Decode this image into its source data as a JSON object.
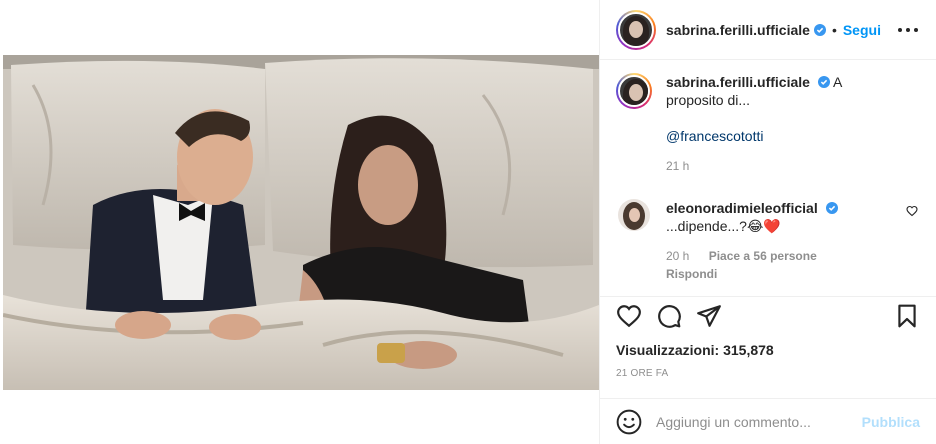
{
  "post": {
    "username": "sabrina.ferilli.ufficiale",
    "follow_label": "Segui",
    "separator": "•"
  },
  "caption": {
    "username": "sabrina.ferilli.ufficiale",
    "text": "A proposito di...",
    "mention": "@francescototti",
    "time": "21 h"
  },
  "comment": {
    "username": "eleonoradimieleofficial",
    "text": "...dipende...?😂❤️",
    "time": "20 h",
    "likes": "Piace a 56 persone",
    "reply_label": "Rispondi"
  },
  "stats": {
    "views_label": "Visualizzazioni:",
    "views_value": "315,878",
    "posted_ago": "21 ORE FA"
  },
  "composer": {
    "placeholder": "Aggiungi un commento...",
    "publish_label": "Pubblica"
  },
  "icons": {
    "verified": "verified-badge-icon",
    "like": "heart-icon",
    "comment": "comment-icon",
    "share": "share-icon",
    "save": "bookmark-icon",
    "emoji": "emoji-icon",
    "more": "more-options-icon"
  },
  "colors": {
    "accent": "#0095f6",
    "publish_disabled": "#b2dffc",
    "muted": "#8e8e8e",
    "text": "#262626"
  }
}
